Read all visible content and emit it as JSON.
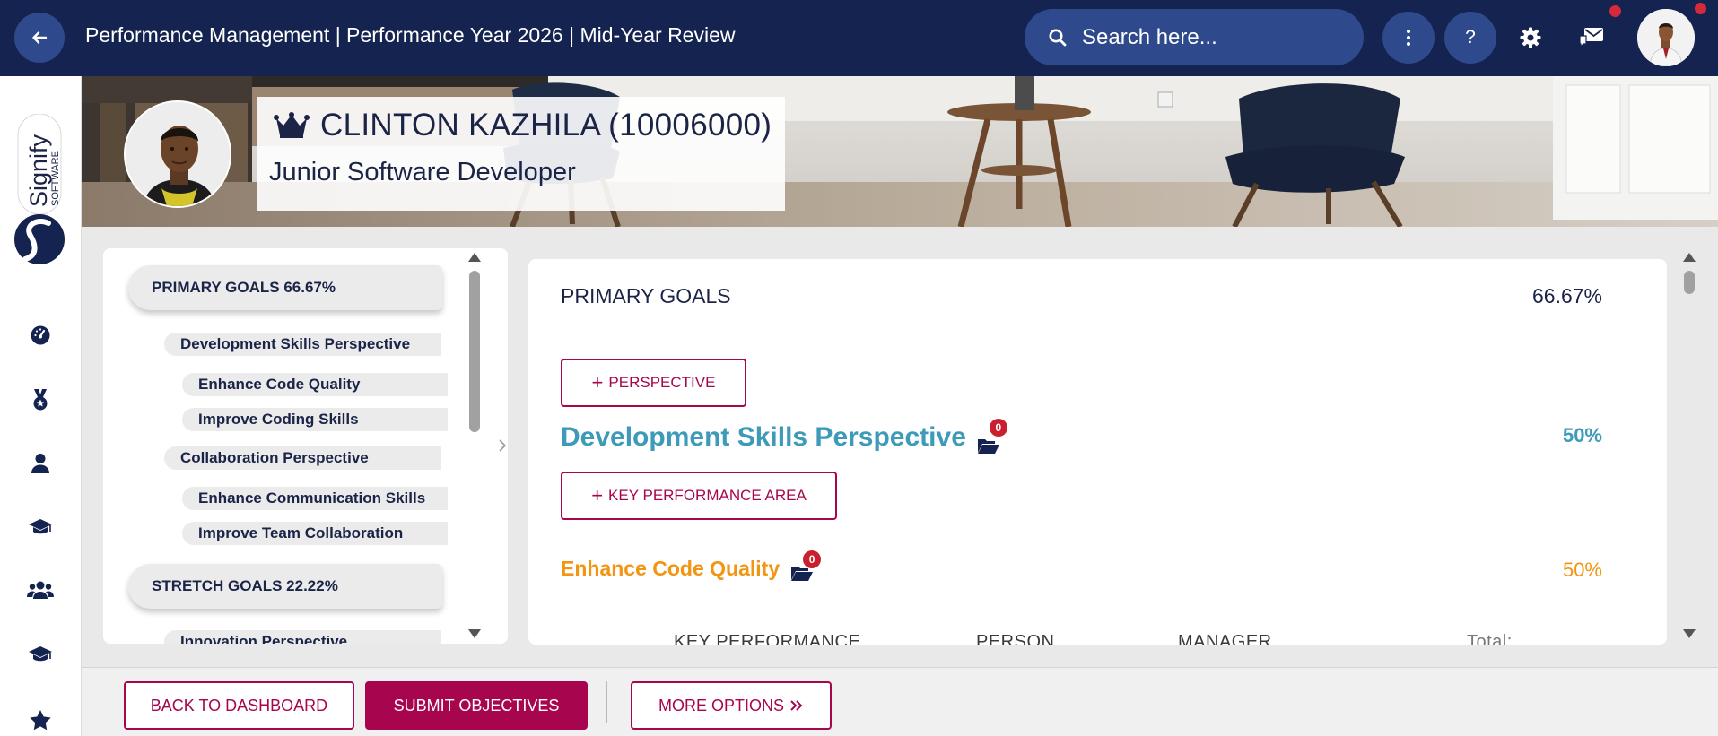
{
  "header": {
    "title": "Performance Management | Performance Year 2026 | Mid-Year Review",
    "search_placeholder": "Search here...",
    "more_label": "⋮",
    "help_label": "?"
  },
  "sidebar": {
    "logo_text": "Signify",
    "logo_sub": "SOFTWARE",
    "icons": [
      "dashboard-icon",
      "medal-icon",
      "user-icon",
      "graduation-cap-icon",
      "team-icon",
      "graduation-cap-icon",
      "star-icon"
    ]
  },
  "profile": {
    "name": "CLINTON KAZHILA (10006000)",
    "job_title": "Junior Software Developer"
  },
  "tree": {
    "primary_goals": "PRIMARY GOALS 66.67%",
    "perspective_1": "Development Skills Perspective",
    "kpa_1": "Enhance Code Quality",
    "kpa_2": "Improve Coding Skills",
    "perspective_2": "Collaboration Perspective",
    "kpa_3": "Enhance Communication Skills",
    "kpa_4": "Improve Team Collaboration",
    "stretch_goals": "STRETCH GOALS 22.22%",
    "perspective_3": "Innovation Perspective"
  },
  "main": {
    "section_title": "PRIMARY GOALS",
    "section_pct": "66.67%",
    "add_perspective": "PERSPECTIVE",
    "perspective_title": "Development Skills Perspective",
    "perspective_badge": "0",
    "perspective_pct": "50%",
    "add_kpa": "KEY PERFORMANCE AREA",
    "kpa_title": "Enhance Code Quality",
    "kpa_badge": "0",
    "kpa_pct": "50%",
    "table_headers": [
      "KEY PERFORMANCE",
      "PERSON",
      "MANAGER",
      "Total:"
    ]
  },
  "footer": {
    "back": "BACK TO DASHBOARD",
    "submit": "SUBMIT OBJECTIVES",
    "more": "MORE OPTIONS"
  },
  "colors": {
    "navy": "#14234f",
    "accent": "#a8054f",
    "perspective": "#3d9ab8",
    "kpa": "#f29512",
    "badge": "#c8202f"
  }
}
